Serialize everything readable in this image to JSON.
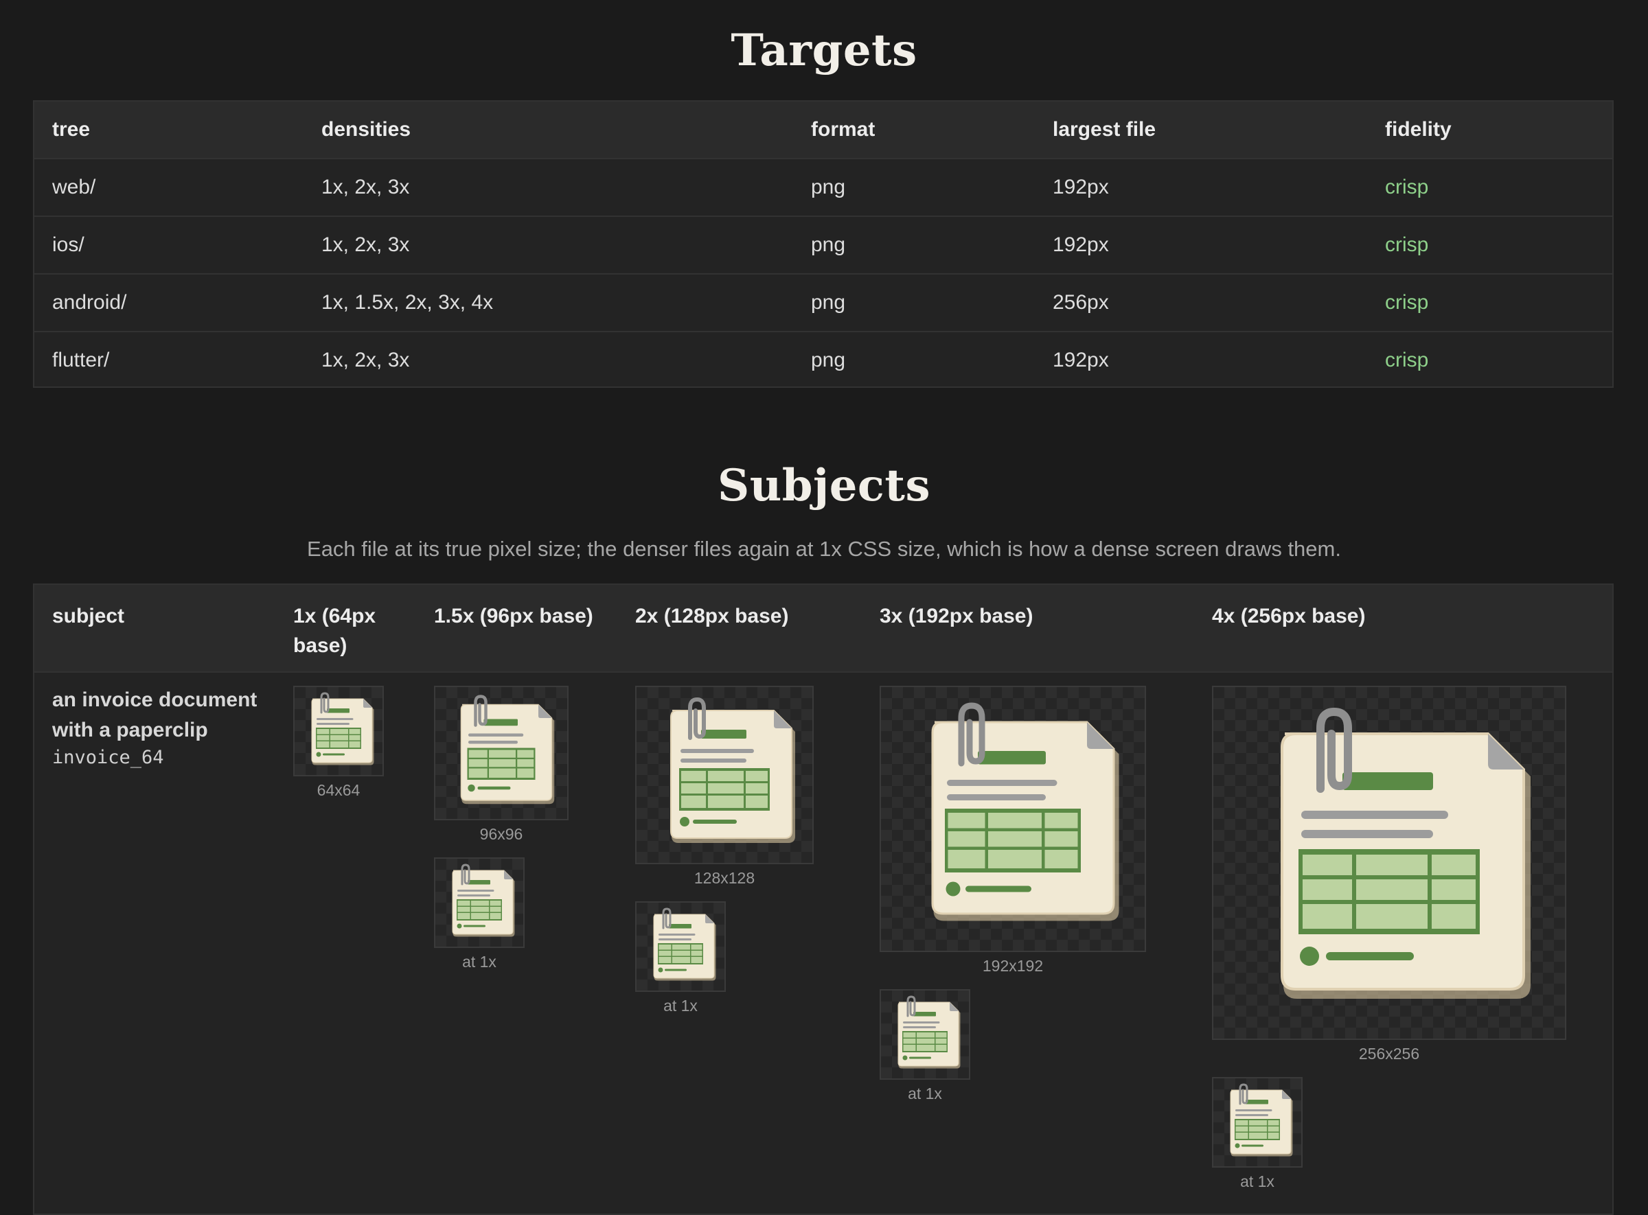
{
  "targets": {
    "title": "Targets",
    "columns": [
      "tree",
      "densities",
      "format",
      "largest file",
      "fidelity"
    ],
    "rows": [
      {
        "tree": "web/",
        "densities": "1x, 2x, 3x",
        "format": "png",
        "largest": "192px",
        "fidelity": "crisp"
      },
      {
        "tree": "ios/",
        "densities": "1x, 2x, 3x",
        "format": "png",
        "largest": "192px",
        "fidelity": "crisp"
      },
      {
        "tree": "android/",
        "densities": "1x, 1.5x, 2x, 3x, 4x",
        "format": "png",
        "largest": "256px",
        "fidelity": "crisp"
      },
      {
        "tree": "flutter/",
        "densities": "1x, 2x, 3x",
        "format": "png",
        "largest": "192px",
        "fidelity": "crisp"
      }
    ],
    "fidelity_color": "#8ed08a"
  },
  "subjects": {
    "title": "Subjects",
    "subtitle": "Each file at its true pixel size; the denser files again at 1x CSS size, which is how a dense screen draws them.",
    "columns": [
      "subject",
      "1x (64px base)",
      "1.5x (96px base)",
      "2x (128px base)",
      "3x (192px base)",
      "4x (256px base)"
    ],
    "subject_name": "an invoice document with a paperclip",
    "subject_id": "invoice_64",
    "captions": {
      "x1": "64x64",
      "x1_5": "96x96",
      "x2": "128x128",
      "x3": "192x192",
      "x4": "256x256",
      "at1x": "at 1x"
    },
    "icon": "invoice-paperclip-icon",
    "colors": {
      "paper": "#f1e9d4",
      "green": "#5a8a45",
      "cell": "#bcd3a0",
      "clip": "#9d9d9d"
    }
  }
}
